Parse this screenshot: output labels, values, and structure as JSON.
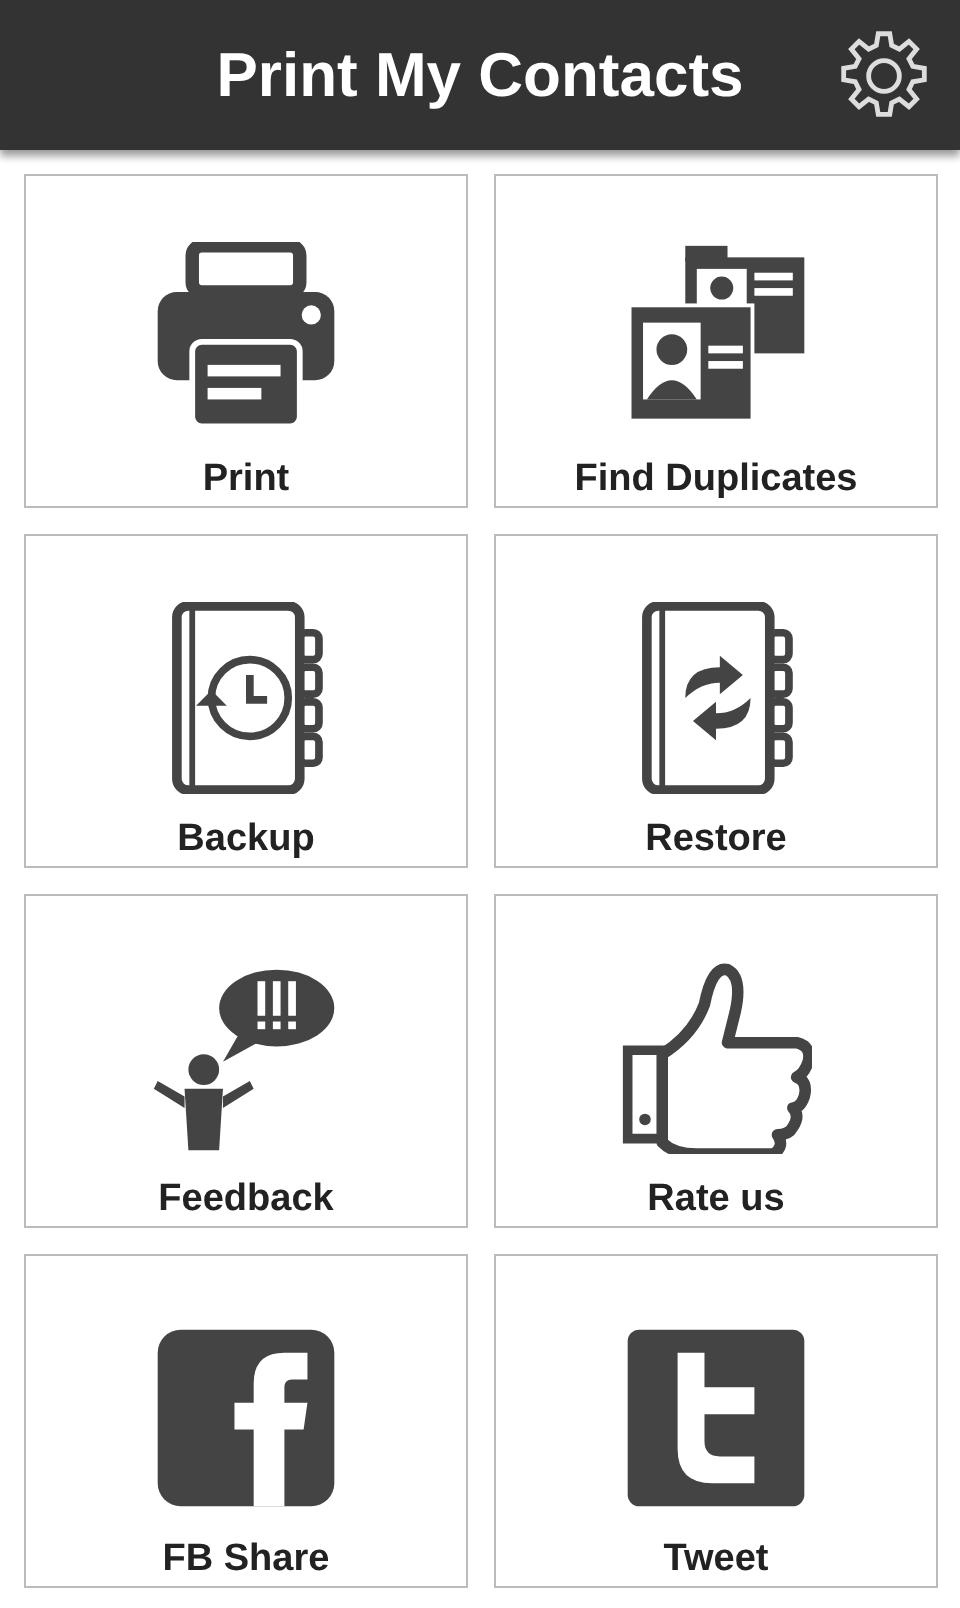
{
  "header": {
    "title": "Print My Contacts"
  },
  "tiles": [
    {
      "label": "Print",
      "kind": "printer"
    },
    {
      "label": "Find Duplicates",
      "kind": "cards"
    },
    {
      "label": "Backup",
      "kind": "backup"
    },
    {
      "label": "Restore",
      "kind": "restore"
    },
    {
      "label": "Feedback",
      "kind": "feedback"
    },
    {
      "label": "Rate us",
      "kind": "thumb"
    },
    {
      "label": "FB Share",
      "kind": "fb"
    },
    {
      "label": "Tweet",
      "kind": "tw"
    }
  ]
}
